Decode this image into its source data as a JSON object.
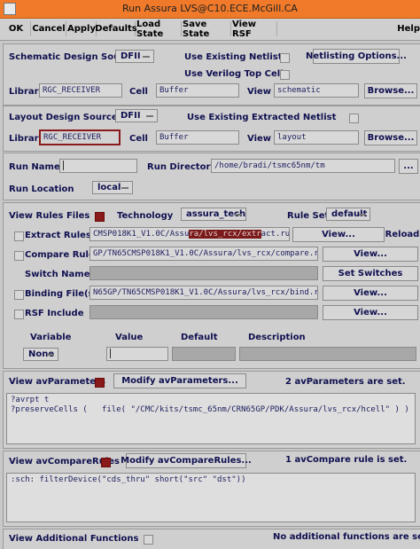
{
  "window": {
    "title": "Run Assura LVS@C10.ECE.McGill.CA"
  },
  "toolbar": {
    "ok": "OK",
    "cancel": "Cancel",
    "apply": "Apply",
    "defaults": "Defaults",
    "load_state": "Load State",
    "save_state": "Save State",
    "view_rsf": "View RSF",
    "help": "Help"
  },
  "schematic": {
    "source_label": "Schematic Design Source",
    "source_value": "DFII",
    "use_existing_netlist": "Use Existing Netlist",
    "use_verilog_top_cell": "Use Verilog Top Cell",
    "netlisting_options": "Netlisting Options...",
    "library_label": "Library",
    "library_value": "RGC_RECEIVER",
    "cell_label": "Cell",
    "cell_value": "Buffer",
    "view_label": "View",
    "view_value": "schematic",
    "browse": "Browse..."
  },
  "layout": {
    "source_label": "Layout Design Source",
    "source_value": "DFII",
    "use_existing_extracted_netlist": "Use Existing Extracted Netlist",
    "library_label": "Library",
    "library_value": "RGC_RECEIVER",
    "cell_label": "Cell",
    "cell_value": "Buffer",
    "view_label": "View",
    "view_value": "layout",
    "browse": "Browse..."
  },
  "run": {
    "run_name_label": "Run Name",
    "run_name_value": "",
    "run_directory_label": "Run Directory",
    "run_directory_value": "/home/bradi/tsmc65nm/tm",
    "dir_browse": "...",
    "run_location_label": "Run Location",
    "run_location_value": "local"
  },
  "rules": {
    "view_rules_files": "View Rules Files",
    "technology_label": "Technology",
    "technology_value": "assura_tech",
    "rule_set_label": "Rule Set",
    "rule_set_value": "default",
    "extract_rules_label": "Extract Rules",
    "extract_pre": "CMSP018K1_V1.0C/Assu",
    "extract_hl": "ra/lvs_rcx/extr",
    "extract_post": "act.rul",
    "extract_view": "View...",
    "reload": "Reload",
    "compare_rules_label": "Compare Rules",
    "compare_value": "GP/TN65CMSP018K1_V1.0C/Assura/lvs_rcx/compare.rul",
    "compare_view": "View...",
    "switch_names_label": "Switch Names",
    "set_switches": "Set Switches",
    "binding_files_label": "Binding File(s)",
    "binding_value": "N65GP/TN65CMSP018K1_V1.0C/Assura/lvs_rcx/bind.rul",
    "binding_view": "View...",
    "rsf_include_label": "RSF Include",
    "rsf_view": "View..."
  },
  "variables": {
    "variable_header": "Variable",
    "value_header": "Value",
    "default_header": "Default",
    "description_header": "Description",
    "variable_value": "None"
  },
  "av_parameters": {
    "label": "View avParameters",
    "modify": "Modify avParameters...",
    "status": "2 avParameters are set.",
    "line1": "?avrpt t",
    "line2": "?preserveCells (   file( \"/CMC/kits/tsmc_65nm/CRN65GP/PDK/Assura/lvs_rcx/hcell\" ) )"
  },
  "av_compare_rules": {
    "label": "View avCompareRules",
    "modify": "Modify avCompareRules...",
    "status": "1 avCompare rule is set.",
    "line1": ":sch: filterDevice(\"cds_thru\" short(\"src\" \"dst\"))"
  },
  "additional_functions": {
    "label": "View Additional Functions",
    "status": "No additional functions are set."
  },
  "colors": {
    "titlebar": "#f07a2a",
    "checked": "#8a1a1a",
    "background": "#c8c8c8"
  }
}
